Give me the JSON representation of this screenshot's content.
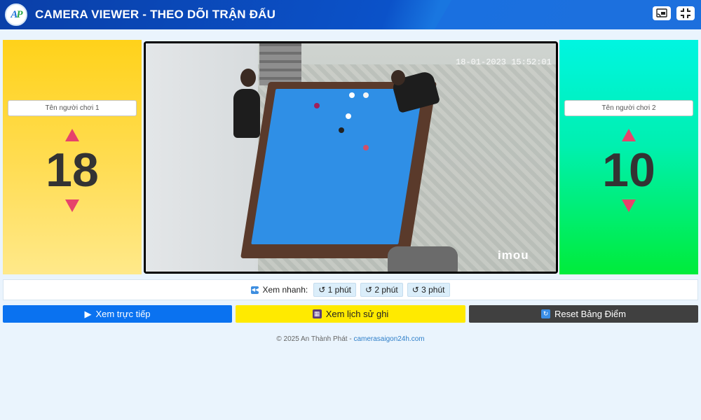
{
  "app": {
    "title": "CAMERA VIEWER - THEO DÕI TRẬN ĐẤU",
    "logo_text": "AP"
  },
  "players": [
    {
      "name_placeholder": "Tên người chơi 1",
      "score": "18"
    },
    {
      "name_placeholder": "Tên người chơi 2",
      "score": "10"
    }
  ],
  "camera": {
    "timestamp": "18-01-2023 15:52:01",
    "watermark": "imou"
  },
  "quick_view": {
    "label": "Xem nhanh:",
    "buttons": [
      "↺ 1 phút",
      "↺ 2 phút",
      "↺ 3 phút"
    ]
  },
  "actions": {
    "live": "Xem trực tiếp",
    "history": "Xem lịch sử ghi",
    "reset": "Reset Bảng Điểm"
  },
  "footer": {
    "copyright": "© 2025 An Thành Phát - ",
    "link": "camerasaigon24h.com"
  },
  "colors": {
    "header": "#0b52c9",
    "live": "#0a72f0",
    "history": "#ffea00",
    "reset": "#404040",
    "arrow": "#e6436b"
  }
}
